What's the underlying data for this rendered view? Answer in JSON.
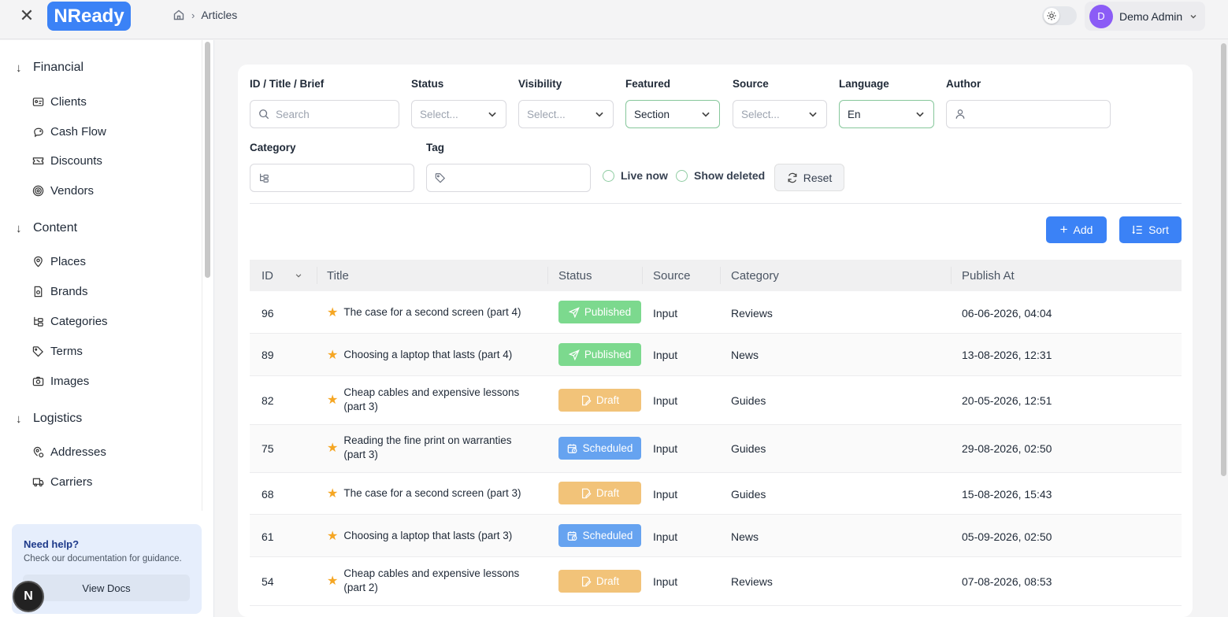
{
  "header": {
    "close_icon": "✕",
    "logo": "NReady",
    "breadcrumb_current": "Articles",
    "user_initial": "D",
    "user_name": "Demo Admin"
  },
  "sidebar": {
    "groups": [
      {
        "label": "Financial",
        "items": [
          "Clients",
          "Cash Flow",
          "Discounts",
          "Vendors"
        ]
      },
      {
        "label": "Content",
        "items": [
          "Places",
          "Brands",
          "Categories",
          "Terms",
          "Images"
        ]
      },
      {
        "label": "Logistics",
        "items": [
          "Addresses",
          "Carriers"
        ]
      }
    ],
    "help_title": "Need help?",
    "help_text": "Check our documentation for guidance.",
    "help_button": "View Docs",
    "fab_label": "N"
  },
  "filters": {
    "id_title_label": "ID / Title / Brief",
    "search_placeholder": "Search",
    "status_label": "Status",
    "status_value": "Select...",
    "visibility_label": "Visibility",
    "visibility_value": "Select...",
    "featured_label": "Featured",
    "featured_value": "Section",
    "source_label": "Source",
    "source_value": "Select...",
    "language_label": "Language",
    "language_value": "En",
    "author_label": "Author",
    "category_label": "Category",
    "tag_label": "Tag",
    "live_now": "Live now",
    "show_deleted": "Show deleted",
    "reset": "Reset"
  },
  "actions": {
    "add": "Add",
    "sort": "Sort"
  },
  "table": {
    "columns": [
      "ID",
      "Title",
      "Status",
      "Source",
      "Category",
      "Publish At"
    ],
    "rows": [
      {
        "id": "96",
        "title": "The case for a second screen (part 4)",
        "status": "Published",
        "source": "Input",
        "category": "Reviews",
        "publish_at": "06-06-2026, 04:04"
      },
      {
        "id": "89",
        "title": "Choosing a laptop that lasts (part 4)",
        "status": "Published",
        "source": "Input",
        "category": "News",
        "publish_at": "13-08-2026, 12:31"
      },
      {
        "id": "82",
        "title": "Cheap cables and expensive lessons (part 3)",
        "status": "Draft",
        "source": "Input",
        "category": "Guides",
        "publish_at": "20-05-2026, 12:51"
      },
      {
        "id": "75",
        "title": "Reading the fine print on warranties (part 3)",
        "status": "Scheduled",
        "source": "Input",
        "category": "Guides",
        "publish_at": "29-08-2026, 02:50"
      },
      {
        "id": "68",
        "title": "The case for a second screen (part 3)",
        "status": "Draft",
        "source": "Input",
        "category": "Guides",
        "publish_at": "15-08-2026, 15:43"
      },
      {
        "id": "61",
        "title": "Choosing a laptop that lasts (part 3)",
        "status": "Scheduled",
        "source": "Input",
        "category": "News",
        "publish_at": "05-09-2026, 02:50"
      },
      {
        "id": "54",
        "title": "Cheap cables and expensive lessons (part 2)",
        "status": "Draft",
        "source": "Input",
        "category": "Reviews",
        "publish_at": "07-08-2026, 08:53"
      }
    ]
  },
  "colors": {
    "accent": "#3b82f6",
    "published": "#7cd98e",
    "draft": "#f2c379",
    "scheduled": "#66a3f0",
    "avatar": "#8b5cf6"
  }
}
